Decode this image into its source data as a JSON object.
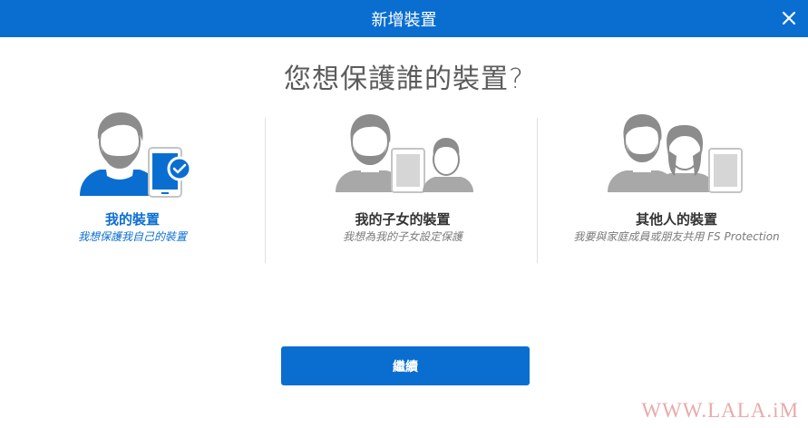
{
  "dialog": {
    "title": "新增裝置",
    "question": "您想保護誰的裝置?",
    "close_icon": "close-icon"
  },
  "options": [
    {
      "title": "我的裝置",
      "description": "我想保護我自己的裝置",
      "selected": true,
      "icon": "person-phone-checked-icon"
    },
    {
      "title": "我的子女的裝置",
      "description": "我想為我的子女設定保護",
      "selected": false,
      "icon": "parent-child-tablet-icon"
    },
    {
      "title": "其他人的裝置",
      "description": "我要與家庭成員或朋友共用 FS Protection",
      "selected": false,
      "icon": "two-people-tablet-icon"
    }
  ],
  "continue_label": "繼續",
  "watermark": "WWW.LALA.iM",
  "colors": {
    "accent": "#0a6ed1",
    "person_gray": "#8c8c8c",
    "device_gray": "#d6d6d6"
  }
}
